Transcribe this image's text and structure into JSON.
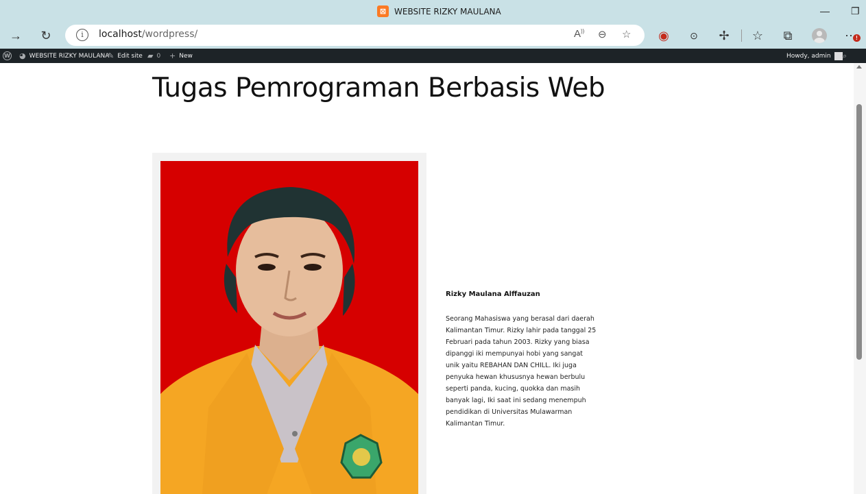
{
  "browser": {
    "tab_title": "WEBSITE RIZKY MAULANA",
    "url_host": "localhost",
    "url_path": "/wordpress/",
    "notification_count": "!"
  },
  "admin_bar": {
    "site_name": "WEBSITE RIZKY MAULANA",
    "edit_site": "Edit site",
    "comments_count": "0",
    "new_label": "New",
    "howdy": "Howdy, admin"
  },
  "post": {
    "title": "Tugas Pemrograman Berbasis Web",
    "author_name": "Rizky Maulana Alffauzan",
    "bio": "Seorang Mahasiswa yang berasal dari daerah Kalimantan Timur. Rizky lahir pada tanggal 25 Februari pada tahun 2003. Rizky yang biasa dipanggi iki mempunyai hobi yang sangat unik yaitu REBAHAN DAN CHILL. Iki juga penyuka hewan khususnya hewan berbulu seperti panda, kucing, quokka dan masih banyak lagi, Iki saat ini sedang menempuh pendidikan di Universitas Mulawarman Kalimantan Timur."
  },
  "colors": {
    "browser_chrome": "#c9e1e6",
    "admin_bar": "#1d2327",
    "photo_background": "#d60000",
    "jacket": "#f5a623"
  }
}
